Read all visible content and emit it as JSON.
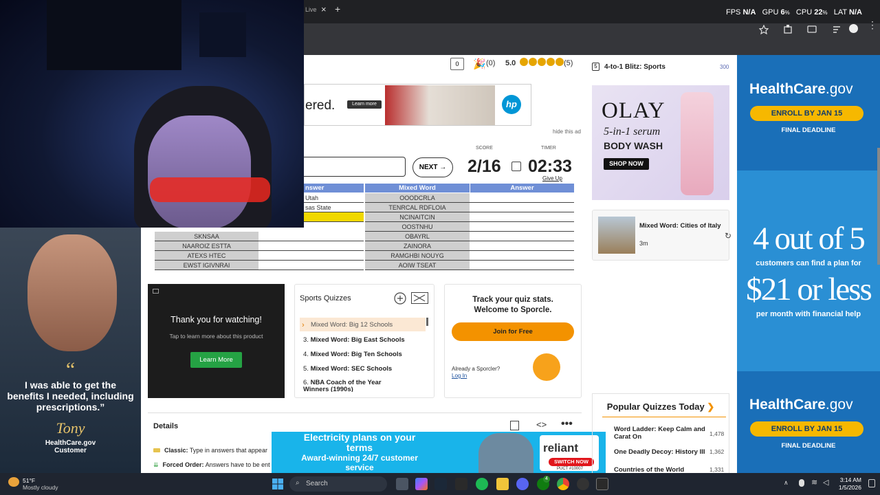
{
  "perf": {
    "fps_label": "FPS",
    "fps_value": "N/A",
    "gpu_label": "GPU",
    "gpu_value": "6",
    "gpu_unit": "%",
    "cpu_label": "CPU",
    "cpu_value": "22",
    "cpu_unit": "%",
    "lat_label": "LAT",
    "lat_value": "N/A"
  },
  "tab": {
    "partial_title": "Live",
    "new_tab": "+",
    "close": "×"
  },
  "quiz_header": {
    "comments": "0",
    "likes": "(0)",
    "rating": "5.0",
    "rating_count": "(5)"
  },
  "ad_top": {
    "partial_text": "ered.",
    "learn_more": "Learn more",
    "brand": "hp",
    "hide": "hide this ad"
  },
  "game": {
    "score_label": "SCORE",
    "score": "2/16",
    "timer_label": "TIMER",
    "timer": "02:33",
    "give_up": "Give Up",
    "next": "NEXT"
  },
  "table_left": {
    "answer_header": "nswer",
    "answers": [
      "Utah",
      "sas State",
      ""
    ],
    "rows": [
      [
        "SKNSAA",
        ""
      ],
      [
        "NAAROIZ ESTTA",
        ""
      ],
      [
        "ATEXS HTEC",
        ""
      ],
      [
        "EWST IGIVNRAI",
        ""
      ]
    ]
  },
  "table_right": {
    "header_mixed": "Mixed Word",
    "header_answer": "Answer",
    "rows": [
      "OOODCRLA",
      "TENRCAL RDFLOIA",
      "NCINAITCIN",
      "OOSTNHU",
      "OBAYRL",
      "ZAINORA",
      "RAMGHBI NOUYG",
      "AOIW TSEAT"
    ]
  },
  "thank_card": {
    "title": "Thank you for watching!",
    "sub": "Tap to learn more about this product",
    "button": "Learn More"
  },
  "sports": {
    "title": "Sports Quizzes",
    "items": [
      {
        "num": "",
        "label": "Mixed Word: Big 12 Schools"
      },
      {
        "num": "3.",
        "label": "Mixed Word: Big East Schools"
      },
      {
        "num": "4.",
        "label": "Mixed Word: Big Ten Schools"
      },
      {
        "num": "5.",
        "label": "Mixed Word: SEC Schools"
      },
      {
        "num": "6.",
        "label": "NBA Coach of the Year Winners (1990s)"
      }
    ]
  },
  "stats_card": {
    "title1": "Track your quiz stats.",
    "title2": "Welcome to Sporcle.",
    "join": "Join for Free",
    "already": "Already a Sporcler?",
    "login": "Log In"
  },
  "details": {
    "title": "Details",
    "classic_label": "Classic:",
    "classic_text": "Type in answers that appear",
    "forced_label": "Forced Order:",
    "forced_text": "Answers have to be ent"
  },
  "sidebar": {
    "blitz_num": "5",
    "blitz_title": "4-to-1 Blitz: Sports",
    "blitz_count": "300",
    "olay": {
      "brand": "OLAY",
      "line1": "5-in-1 serum",
      "line2": "BODY WASH",
      "cta": "SHOP NOW"
    },
    "related": {
      "title": "Mixed Word: Cities of Italy",
      "time": "3m"
    },
    "popular_title": "Popular Quizzes Today",
    "popular": [
      {
        "title": "Word Ladder: Keep Calm and Carat On",
        "count": "1,478"
      },
      {
        "title": "One Deadly Decoy: History III",
        "count": "1,362"
      },
      {
        "title": "Countries of the World",
        "count": "1,331"
      }
    ]
  },
  "right_ad": {
    "brand": "HealthCare",
    "brand_tld": ".gov",
    "enroll": "ENROLL BY JAN 15",
    "deadline": "FINAL DEADLINE",
    "big": "4 out of 5",
    "mid": "customers can find a plan for",
    "price": "$21 or less",
    "tail": "per month with financial help"
  },
  "left_ad": {
    "quote": "I was able to get the benefits I needed, including prescriptions.”",
    "name": "Tony",
    "org": "HealthCare.gov",
    "role": "Customer"
  },
  "bottom_ad": {
    "line1": "Electricity plans on your",
    "line2": "terms",
    "line3": "Award-winning 24/7 customer",
    "line4": "service",
    "brand": "reliant",
    "cta": "SWITCH NOW",
    "code": "PUCT #10007"
  },
  "taskbar": {
    "temp": "51°F",
    "weather": "Mostly cloudy",
    "search": "Search",
    "time": "3:14 AM",
    "date": "1/5/2026",
    "badge": "4"
  }
}
